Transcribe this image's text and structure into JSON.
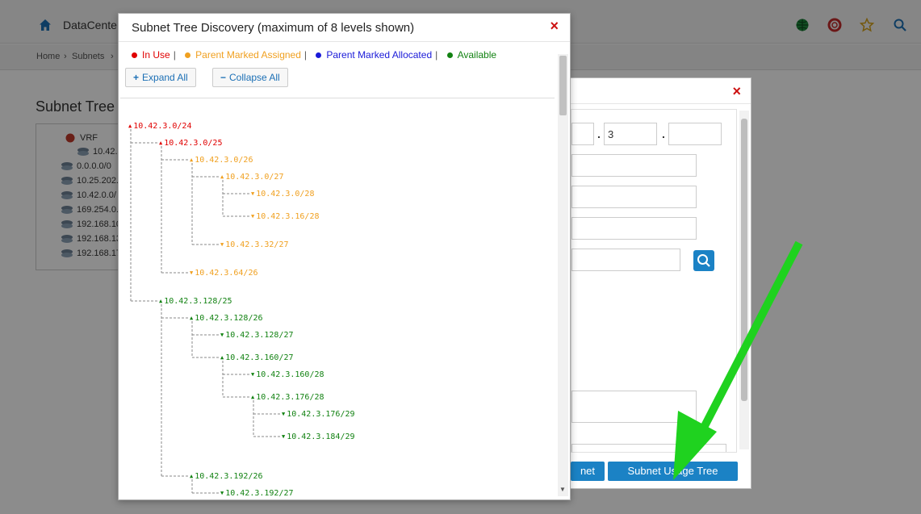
{
  "app": {
    "brand": "DataCente",
    "breadcrumb": [
      "Home",
      "›",
      "Subnets",
      "›"
    ],
    "page_title": "Subnet Tree",
    "bg_tree": [
      "VRF",
      "10.42.3",
      "0.0.0.0/0",
      "10.25.202.",
      "10.42.0.0/",
      "169.254.0.",
      "192.168.10",
      "192.168.13",
      "192.168.17"
    ]
  },
  "back_modal": {
    "ip_octet_3": "3",
    "ip_sep": ".",
    "button_left": "net",
    "button_usage_tree": "Subnet Usage Tree"
  },
  "modal": {
    "title": "Subnet Tree Discovery (maximum of 8 levels shown)",
    "close": "×",
    "legend": [
      {
        "label": "In Use",
        "color": "#e00000"
      },
      {
        "label": "Parent Marked Assigned",
        "color": "#f0a020"
      },
      {
        "label": "Parent Marked Allocated",
        "color": "#1a1ad8"
      },
      {
        "label": "Available",
        "color": "#128212"
      }
    ],
    "legend_sep": "|",
    "expand_all": "Expand All",
    "collapse_all": "Collapse All",
    "icons": {
      "expand": "plus-icon",
      "collapse": "minus-icon",
      "close": "close-icon"
    }
  },
  "colors": {
    "in_use": "#e00000",
    "assigned": "#f0a020",
    "allocated": "#1a1ad8",
    "available": "#128212"
  },
  "tree": [
    {
      "label": "10.42.3.0/24",
      "status": "in_use",
      "caret": "up"
    },
    {
      "label": "10.42.3.0/25",
      "status": "in_use",
      "caret": "up"
    },
    {
      "label": "10.42.3.0/26",
      "status": "assigned",
      "caret": "up"
    },
    {
      "label": "10.42.3.0/27",
      "status": "assigned",
      "caret": "up"
    },
    {
      "label": "10.42.3.0/28",
      "status": "assigned",
      "caret": "down"
    },
    {
      "label": "10.42.3.16/28",
      "status": "assigned",
      "caret": "down"
    },
    {
      "label": "10.42.3.32/27",
      "status": "assigned",
      "caret": "down"
    },
    {
      "label": "10.42.3.64/26",
      "status": "assigned",
      "caret": "down"
    },
    {
      "label": "10.42.3.128/25",
      "status": "available",
      "caret": "up"
    },
    {
      "label": "10.42.3.128/26",
      "status": "available",
      "caret": "up"
    },
    {
      "label": "10.42.3.128/27",
      "status": "available",
      "caret": "down"
    },
    {
      "label": "10.42.3.160/27",
      "status": "available",
      "caret": "up"
    },
    {
      "label": "10.42.3.160/28",
      "status": "available",
      "caret": "down"
    },
    {
      "label": "10.42.3.176/28",
      "status": "available",
      "caret": "up"
    },
    {
      "label": "10.42.3.176/29",
      "status": "available",
      "caret": "down"
    },
    {
      "label": "10.42.3.184/29",
      "status": "available",
      "caret": "down"
    },
    {
      "label": "10.42.3.192/26",
      "status": "available",
      "caret": "up"
    },
    {
      "label": "10.42.3.192/27",
      "status": "available",
      "caret": "down"
    }
  ]
}
